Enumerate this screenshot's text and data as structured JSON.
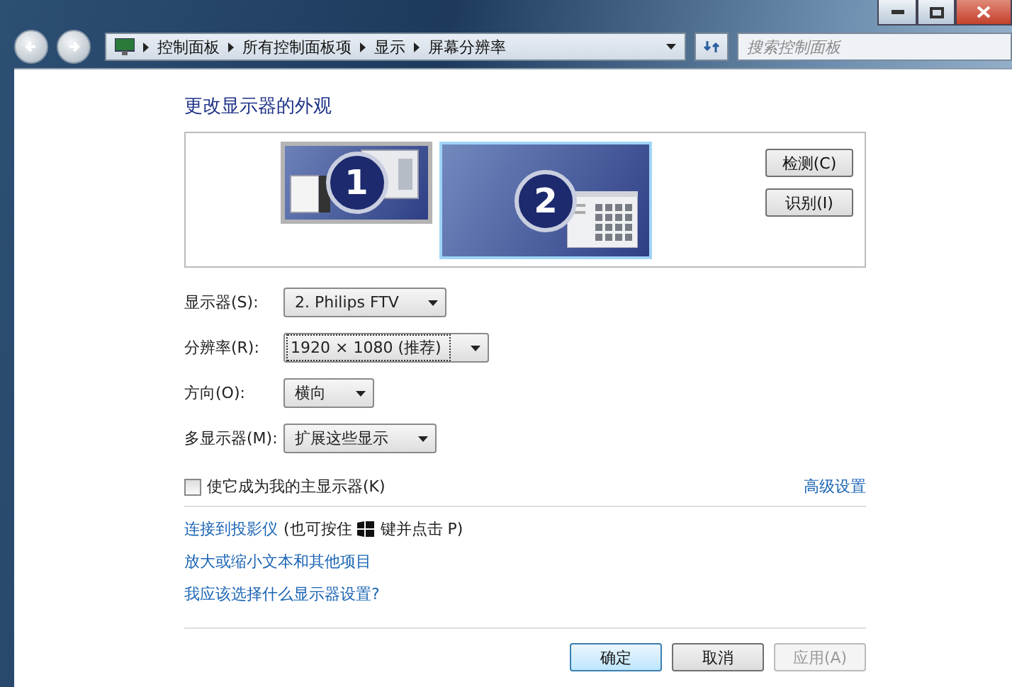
{
  "address_bar": {
    "crumbs": [
      "控制面板",
      "所有控制面板项",
      "显示",
      "屏幕分辨率"
    ]
  },
  "search": {
    "placeholder": "搜索控制面板"
  },
  "heading": "更改显示器的外观",
  "monitors": [
    {
      "number": "1",
      "selected": false
    },
    {
      "number": "2",
      "selected": true
    }
  ],
  "side_buttons": [
    "检测(C)",
    "识别(I)"
  ],
  "settings": [
    {
      "label": "显示器(S):",
      "value": "2. Philips FTV",
      "focused": false
    },
    {
      "label": "分辨率(R):",
      "value": "1920 × 1080 (推荐)",
      "focused": true
    },
    {
      "label": "方向(O):",
      "value": "横向",
      "focused": false
    },
    {
      "label": "多显示器(M):",
      "value": "扩展这些显示",
      "focused": false
    }
  ],
  "primary_checkbox": {
    "label": "使它成为我的主显示器(K)",
    "checked": false
  },
  "advanced_link": "高级设置",
  "projector": {
    "link": "连接到投影仪",
    "hint_before": "(也可按住",
    "hint_after": "键并点击 P)"
  },
  "links": [
    "放大或缩小文本和其他项目",
    "我应该选择什么显示器设置?"
  ],
  "buttons": [
    {
      "label": "确定",
      "default": true,
      "disabled": false
    },
    {
      "label": "取消",
      "default": false,
      "disabled": false
    },
    {
      "label": "应用(A)",
      "default": false,
      "disabled": true
    }
  ]
}
